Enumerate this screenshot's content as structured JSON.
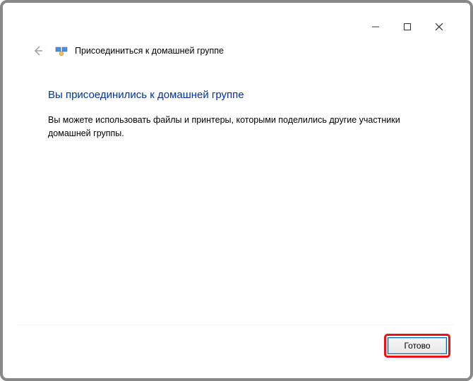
{
  "titlebar": {
    "minimize_icon": "minimize-icon",
    "maximize_icon": "maximize-icon",
    "close_icon": "close-icon"
  },
  "header": {
    "back_icon": "back-arrow-icon",
    "app_icon": "homegroup-icon",
    "title": "Присоединиться к домашней группе"
  },
  "content": {
    "heading": "Вы присоединились к домашней группе",
    "body": "Вы можете использовать файлы и принтеры, которыми поделились другие участники домашней группы."
  },
  "footer": {
    "done_label": "Готово"
  }
}
